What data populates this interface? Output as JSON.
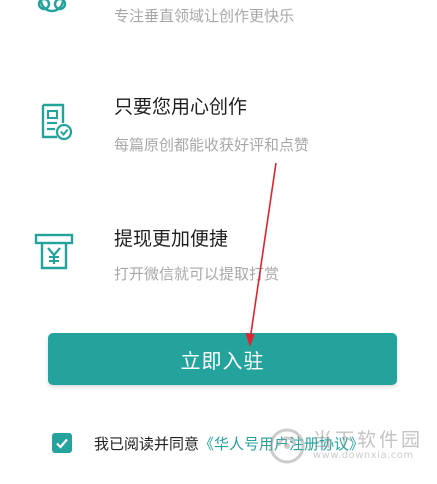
{
  "features": [
    {
      "title": "",
      "subtitle": "专注垂直领域让创作更快乐",
      "icon": "network-icon"
    },
    {
      "title": "只要您用心创作",
      "subtitle": "每篇原创都能收获好评和点赞",
      "icon": "document-check-icon"
    },
    {
      "title": "提现更加便捷",
      "subtitle": "打开微信就可以提取打赏",
      "icon": "atm-yuan-icon"
    }
  ],
  "cta": {
    "label": "立即入驻"
  },
  "agreement": {
    "text": "我已阅读并同意",
    "link": "《华人号用户注册协议》",
    "checked": true
  },
  "watermark": {
    "name": "当下软件园",
    "url": "www.downxia.com"
  },
  "colors": {
    "accent": "#23a39b",
    "subtitle": "#a8a8a8",
    "arrow": "#e0232e"
  }
}
